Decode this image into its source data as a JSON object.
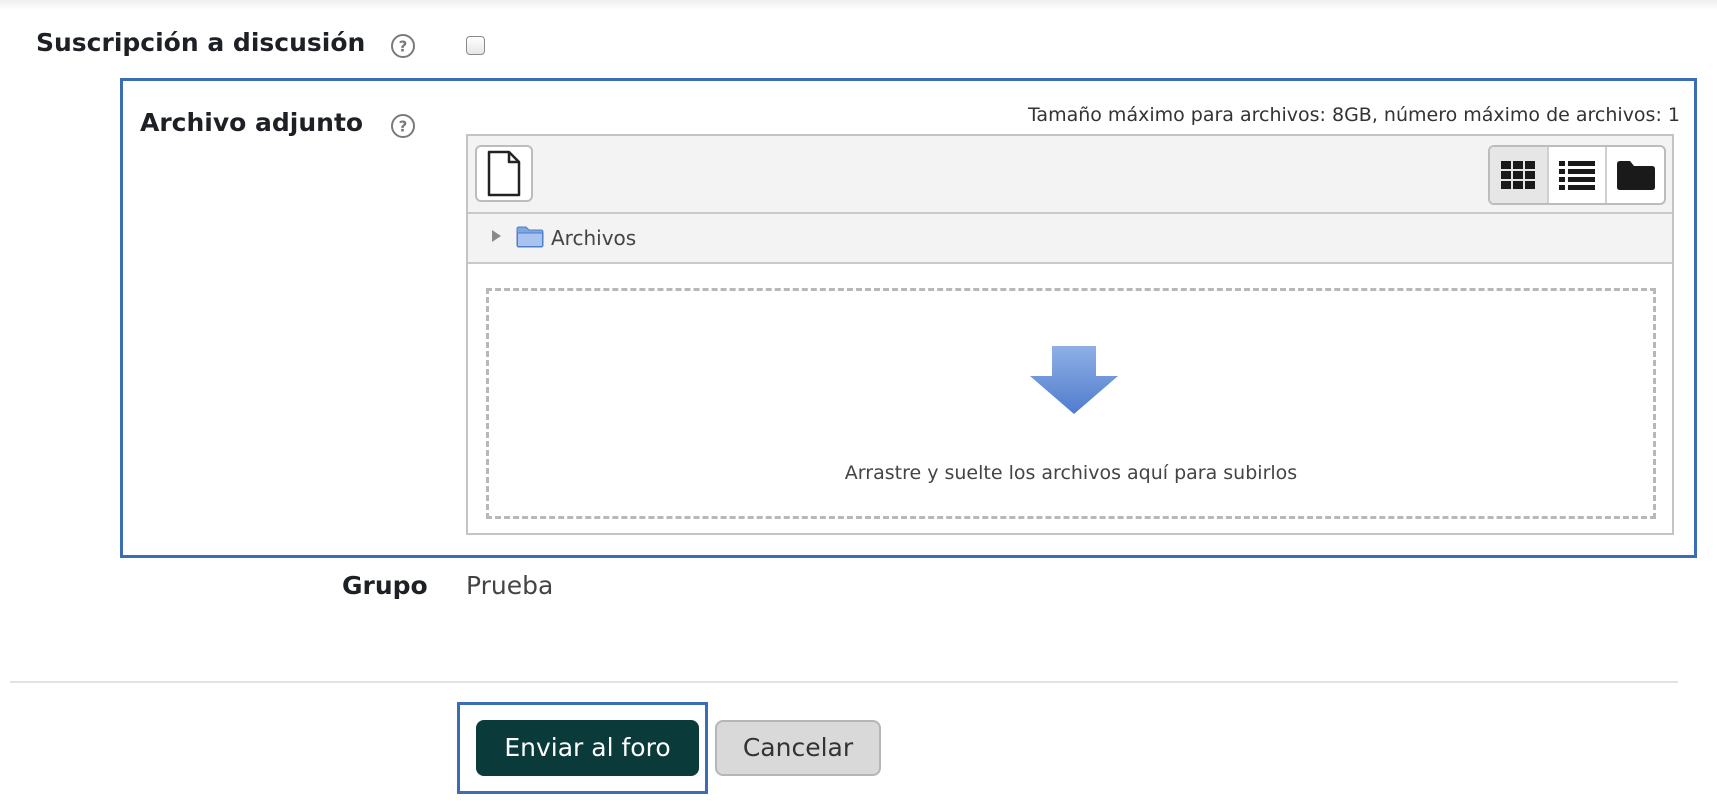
{
  "form": {
    "subscription": {
      "label": "Suscripción a discusión",
      "checked": false
    },
    "attachment": {
      "label": "Archivo adjunto",
      "max_info": "Tamaño máximo para archivos: 8GB, número máximo de archivos: 1",
      "path_label": "Archivos",
      "drop_text": "Arrastre y suelte los archivos aquí para subirlos",
      "views": [
        "icons-view-icon",
        "list-view-icon",
        "tree-view-icon"
      ],
      "active_view": "icons-view-icon"
    },
    "group": {
      "label": "Grupo",
      "value": "Prueba"
    }
  },
  "actions": {
    "submit_label": "Enviar al foro",
    "cancel_label": "Cancelar"
  },
  "colors": {
    "highlight": "#3b6db5",
    "primary_button": "#0b3a3a",
    "drop_arrow": "#5b85d0"
  }
}
